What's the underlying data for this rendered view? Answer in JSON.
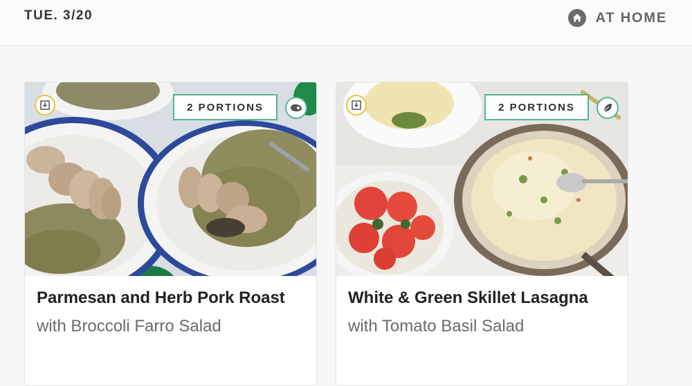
{
  "header": {
    "date": "TUE. 3/20",
    "location_label": "AT HOME",
    "location_icon": "home-icon"
  },
  "cards": [
    {
      "portions": "2 PORTIONS",
      "title": "Parmesan and Herb Pork Roast",
      "subtitle": "with Broccoli Farro Salad",
      "protein_icon": "meat-icon",
      "action_icon": "download-icon"
    },
    {
      "portions": "2 PORTIONS",
      "title": "White & Green Skillet Lasagna",
      "subtitle": "with Tomato Basil Salad",
      "protein_icon": "leaf-icon",
      "action_icon": "download-icon"
    }
  ],
  "colors": {
    "accent_green": "#4fb88f",
    "badge_yellow": "#e8c53a"
  }
}
